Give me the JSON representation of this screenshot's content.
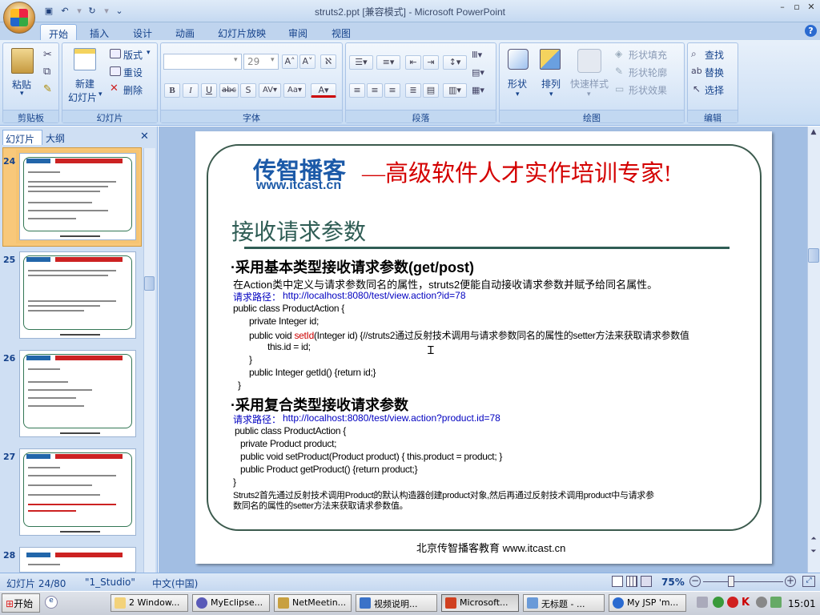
{
  "window": {
    "title": "struts2.ppt [兼容模式] - Microsoft PowerPoint",
    "help_label": "?"
  },
  "tabs": [
    "开始",
    "插入",
    "设计",
    "动画",
    "幻灯片放映",
    "审阅",
    "视图"
  ],
  "ribbon": {
    "clipboard": {
      "label": "剪贴板",
      "paste": "粘贴"
    },
    "slides": {
      "label": "幻灯片",
      "new_slide": "新建",
      "new_slide2": "幻灯片",
      "layout": "版式",
      "reset": "重设",
      "delete": "删除"
    },
    "font": {
      "label": "字体",
      "font_size": "29"
    },
    "paragraph": {
      "label": "段落"
    },
    "drawing": {
      "label": "绘图",
      "shapes": "形状",
      "arrange": "排列",
      "quick_styles": "快速样式",
      "fill": "形状填充",
      "outline": "形状轮廓",
      "effects": "形状效果"
    },
    "editing": {
      "label": "编辑",
      "find": "查找",
      "replace": "替换",
      "select": "选择"
    }
  },
  "panel": {
    "tab_slides": "幻灯片",
    "tab_outline": "大纲",
    "thumbs": [
      "24",
      "25",
      "26",
      "27",
      "28"
    ]
  },
  "slide": {
    "brand_name": "传智播客",
    "brand_url": "www.itcast.cn",
    "slogan": "—高级软件人才实作培训专家!",
    "heading": "接收请求参数",
    "sec1_title": "·采用基本类型接收请求参数(get/post)",
    "sec1_desc": "在Action类中定义与请求参数同名的属性，struts2便能自动接收请求参数并赋予给同名属性。",
    "sec1_path_label": "请求路径：",
    "sec1_path_url": "http://localhost:8080/test/view.action?id=78",
    "code1": [
      "public class ProductAction {",
      "private Integer id;",
      "public void ",
      "setId",
      "(Integer id) {//struts2通过反射技术调用与请求参数同名的属性的setter方法来获取请求参数值",
      "this.id = id;",
      "}",
      "public Integer getId() {return id;}",
      "}"
    ],
    "sec2_title": "·采用复合类型接收请求参数",
    "sec2_path_label": "请求路径：",
    "sec2_path_url": "http://localhost:8080/test/view.action?product.id=78",
    "code2": [
      "public class ProductAction {",
      "private Product product;",
      "public void setProduct(Product product) {  this.product = product;  }",
      "public Product getProduct() {return product;}",
      "}"
    ],
    "note1": "Struts2首先通过反射技术调用Product的默认构造器创建product对象,然后再通过反射技术调用product中与请求参",
    "note2": "数同名的属性的setter方法来获取请求参数值。",
    "footer": "北京传智播客教育 www.itcast.cn"
  },
  "status": {
    "slide_info": "幻灯片 24/80",
    "theme": "\"1_Studio\"",
    "language": "中文(中国)",
    "zoom": "75%"
  },
  "taskbar": {
    "start": "开始",
    "tasks": [
      "2 Window...",
      "MyEclipse...",
      "NetMeetin...",
      "视频说明...",
      "Microsoft...",
      "无标题 - ...",
      "My JSP 'm..."
    ],
    "clock": "15:01"
  }
}
